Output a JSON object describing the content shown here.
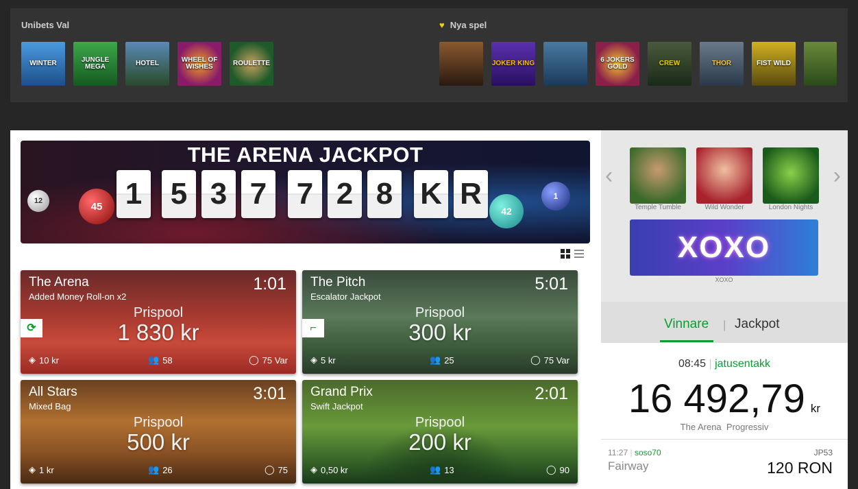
{
  "top": {
    "unibet_title": "Unibets Val",
    "new_title": "Nya spel",
    "unibet_games": [
      {
        "label": "Winter",
        "color": "#2c6fb5"
      },
      {
        "label": "Jungle Mega",
        "color": "#1d7a2c"
      },
      {
        "label": "Hotel",
        "color": "#2f5b84"
      },
      {
        "label": "Wheel of Wishes",
        "color": "#8a2a7a"
      },
      {
        "label": "Roulette",
        "color": "#1e5a2a"
      }
    ],
    "new_games": [
      {
        "label": "",
        "color": "#5a3a20"
      },
      {
        "label": "Joker King",
        "color": "#3a1f7a"
      },
      {
        "label": "",
        "color": "#2a4c6a"
      },
      {
        "label": "6 Jokers Gold",
        "color": "#8a1f4a"
      },
      {
        "label": "Crew",
        "color": "#2a3a2a"
      },
      {
        "label": "Thor",
        "color": "#3a4a5a"
      },
      {
        "label": "Fist Wild",
        "color": "#7a6a1a"
      },
      {
        "label": "",
        "color": "#4a6a2a"
      }
    ]
  },
  "jackpot": {
    "title": "THE ARENA JACKPOT",
    "digits": [
      "1",
      "5",
      "3",
      "7",
      "7",
      "2",
      "8",
      "K",
      "R"
    ],
    "balls": [
      "12",
      "45",
      "42",
      "1"
    ]
  },
  "cards": [
    {
      "title": "The Arena",
      "subtitle": "Added Money Roll-on x2",
      "time": "1:01",
      "prize_label": "Prispool",
      "prize": "1 830 kr",
      "cost": "10 kr",
      "players": "58",
      "rows": "75 Var",
      "badge": "refresh-icon",
      "bg": "#b5342c"
    },
    {
      "title": "The Pitch",
      "subtitle": "Escalator Jackpot",
      "time": "5:01",
      "prize_label": "Prispool",
      "prize": "300 kr",
      "cost": "5 kr",
      "players": "25",
      "rows": "75 Var",
      "badge": "stairs-icon",
      "bg": "#3c5a40"
    },
    {
      "title": "All Stars",
      "subtitle": "Mixed Bag",
      "time": "3:01",
      "prize_label": "Prispool",
      "prize": "500 kr",
      "cost": "1 kr",
      "players": "26",
      "rows": "75",
      "badge": "",
      "bg": "#8a5524"
    },
    {
      "title": "Grand Prix",
      "subtitle": "Swift Jackpot",
      "time": "2:01",
      "prize_label": "Prispool",
      "prize": "200 kr",
      "cost": "0,50 kr",
      "players": "13",
      "rows": "90",
      "badge": "",
      "bg": "#2f6a2c"
    }
  ],
  "side": {
    "slots": [
      {
        "label": "Temple Tumble",
        "color": "#4e7a3a"
      },
      {
        "label": "Wild Wonder",
        "color": "#a8232e"
      },
      {
        "label": "London Nights",
        "color": "#1e7a2e"
      }
    ],
    "featured_logo": "XOXO",
    "featured_label": "XOXO",
    "tabs": {
      "winners": "Vinnare",
      "jackpot": "Jackpot"
    },
    "win": {
      "time": "08:45",
      "user": "jatusentakk",
      "amount": "16 492,79",
      "unit": "kr",
      "game": "The Arena",
      "type": "Progressiv"
    },
    "recent": {
      "time": "11:27",
      "user": "soso70",
      "code": "JP53",
      "game": "Fairway",
      "amount": "120 RON"
    }
  }
}
